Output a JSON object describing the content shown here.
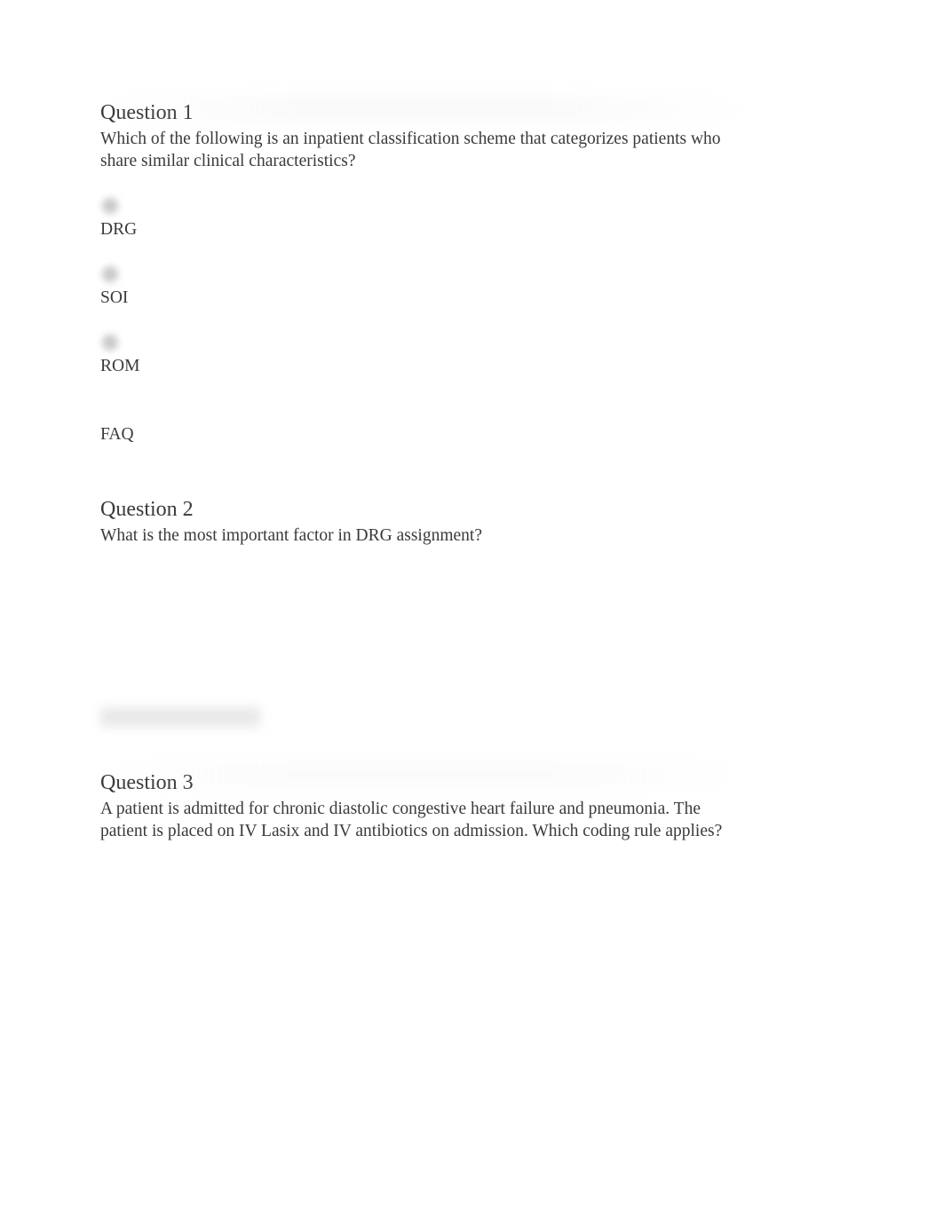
{
  "questions": [
    {
      "title": "Question 1",
      "text": "Which of the following is an inpatient classification scheme that categorizes patients who share similar clinical characteristics?",
      "options": [
        {
          "label": "DRG",
          "show_radio": true
        },
        {
          "label": "SOI",
          "show_radio": true
        },
        {
          "label": "ROM",
          "show_radio": true
        },
        {
          "label": "FAQ",
          "show_radio": false
        }
      ]
    },
    {
      "title": "Question 2",
      "text": "What is the most important factor in DRG assignment?"
    },
    {
      "title": "Question 3",
      "text": "A patient is admitted for chronic diastolic congestive heart failure and pneumonia. The patient is placed on IV Lasix and IV antibiotics on admission. Which coding rule applies?"
    }
  ]
}
